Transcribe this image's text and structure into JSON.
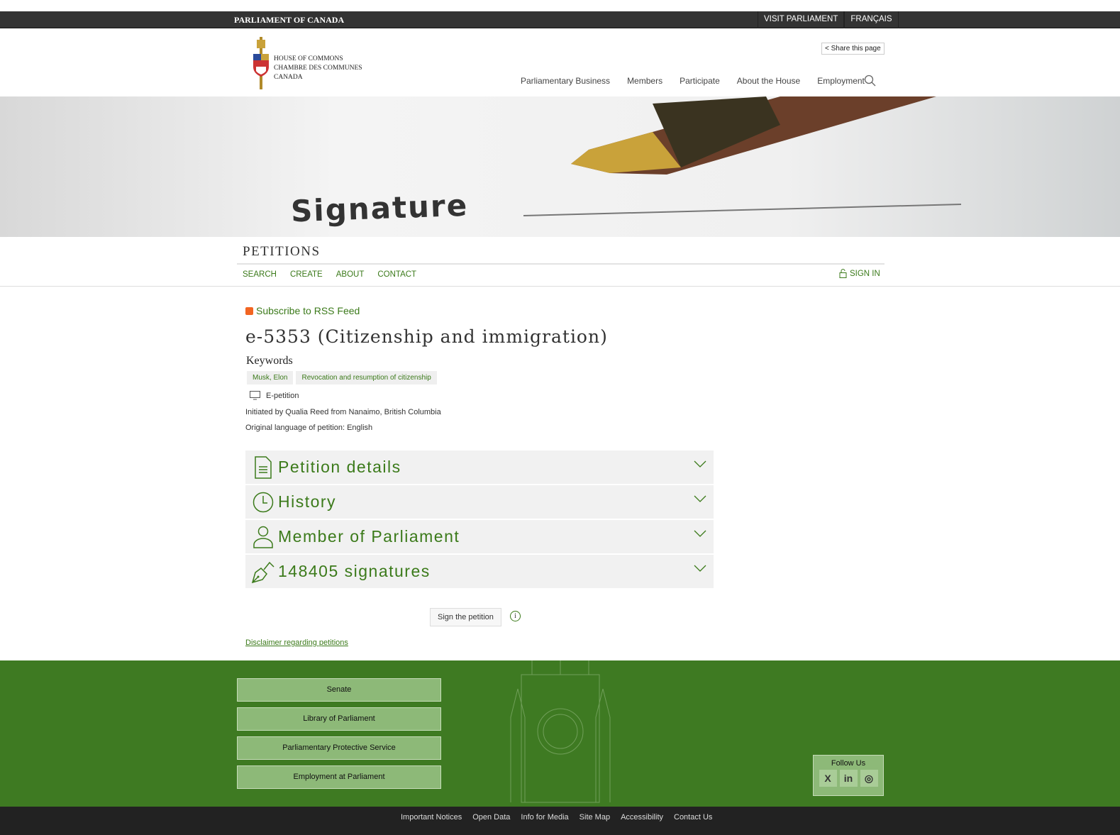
{
  "topbar": {
    "brand": "PARLIAMENT OF CANADA",
    "visit": "VISIT PARLIAMENT",
    "lang": "FRANÇAIS"
  },
  "header": {
    "logo_lines": [
      "HOUSE OF COMMONS",
      "CHAMBRE DES COMMUNES",
      "CANADA"
    ],
    "share": "Share this page",
    "nav": [
      "Parliamentary Business",
      "Members",
      "Participate",
      "About the House",
      "Employment"
    ]
  },
  "banner": {
    "image_text": "Signature"
  },
  "section": {
    "title": "PETITIONS",
    "nav": [
      "SEARCH",
      "CREATE",
      "ABOUT",
      "CONTACT"
    ],
    "signin": "SIGN IN"
  },
  "petition": {
    "rss": "Subscribe to RSS Feed",
    "title": "e-5353 (Citizenship and immigration)",
    "keywords_label": "Keywords",
    "keywords": [
      "Musk, Elon",
      "Revocation and resumption of citizenship"
    ],
    "type": "E-petition",
    "initiated": "Initiated by Qualia Reed from Nanaimo, British Columbia",
    "language": "Original language of petition: English",
    "sections": [
      "Petition details",
      "History",
      "Member of Parliament",
      "148405 signatures"
    ],
    "sign_button": "Sign the petition",
    "info_icon": "i",
    "disclaimer": "Disclaimer regarding petitions"
  },
  "footer": {
    "buttons": [
      "Senate",
      "Library of Parliament",
      "Parliamentary Protective Service",
      "Employment at Parliament"
    ],
    "follow": "Follow Us",
    "social": [
      "X",
      "in",
      "◎"
    ],
    "links": [
      "Important Notices",
      "Open Data",
      "Info for Media",
      "Site Map",
      "Accessibility",
      "Contact Us"
    ]
  },
  "colors": {
    "accent": "#3b7a1a",
    "footer": "#3e7a22",
    "topbar": "#333333"
  }
}
